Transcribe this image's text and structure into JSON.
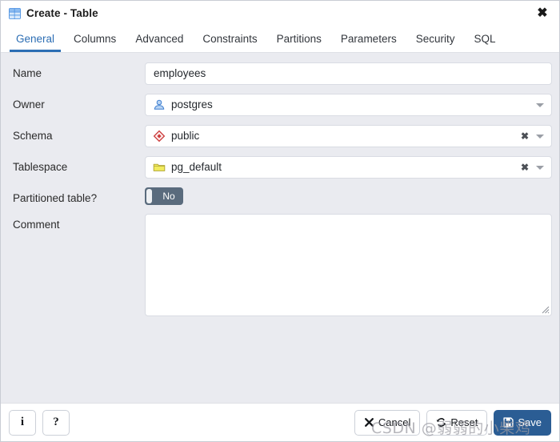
{
  "window": {
    "title": "Create - Table",
    "icon": "table-icon",
    "close_label": "✖"
  },
  "tabs": [
    {
      "label": "General",
      "active": true
    },
    {
      "label": "Columns",
      "active": false
    },
    {
      "label": "Advanced",
      "active": false
    },
    {
      "label": "Constraints",
      "active": false
    },
    {
      "label": "Partitions",
      "active": false
    },
    {
      "label": "Parameters",
      "active": false
    },
    {
      "label": "Security",
      "active": false
    },
    {
      "label": "SQL",
      "active": false
    }
  ],
  "form": {
    "name": {
      "label": "Name",
      "value": "employees",
      "placeholder": ""
    },
    "owner": {
      "label": "Owner",
      "value": "postgres",
      "icon": "user-icon",
      "has_clear": false,
      "has_caret": true
    },
    "schema": {
      "label": "Schema",
      "value": "public",
      "icon": "schema-diamond-icon",
      "has_clear": true,
      "clear_label": "✖",
      "has_caret": true
    },
    "tablespace": {
      "label": "Tablespace",
      "value": "pg_default",
      "icon": "folder-icon",
      "has_clear": true,
      "clear_label": "✖",
      "has_caret": true
    },
    "partitioned": {
      "label": "Partitioned table?",
      "value": "No",
      "state": "off"
    },
    "comment": {
      "label": "Comment",
      "value": "",
      "placeholder": ""
    }
  },
  "footer": {
    "info_label": "i",
    "help_label": "?",
    "cancel_label": "Cancel",
    "reset_label": "Reset",
    "save_label": "Save"
  },
  "watermark": {
    "text": "CSDN @弱弱的小柴鸡"
  },
  "colors": {
    "accent": "#2c6eb4",
    "primary_button": "#2b5d94",
    "body_bg": "#eaebf0",
    "panel_bg": "#ffffff",
    "toggle_off": "#5a6b7d"
  }
}
